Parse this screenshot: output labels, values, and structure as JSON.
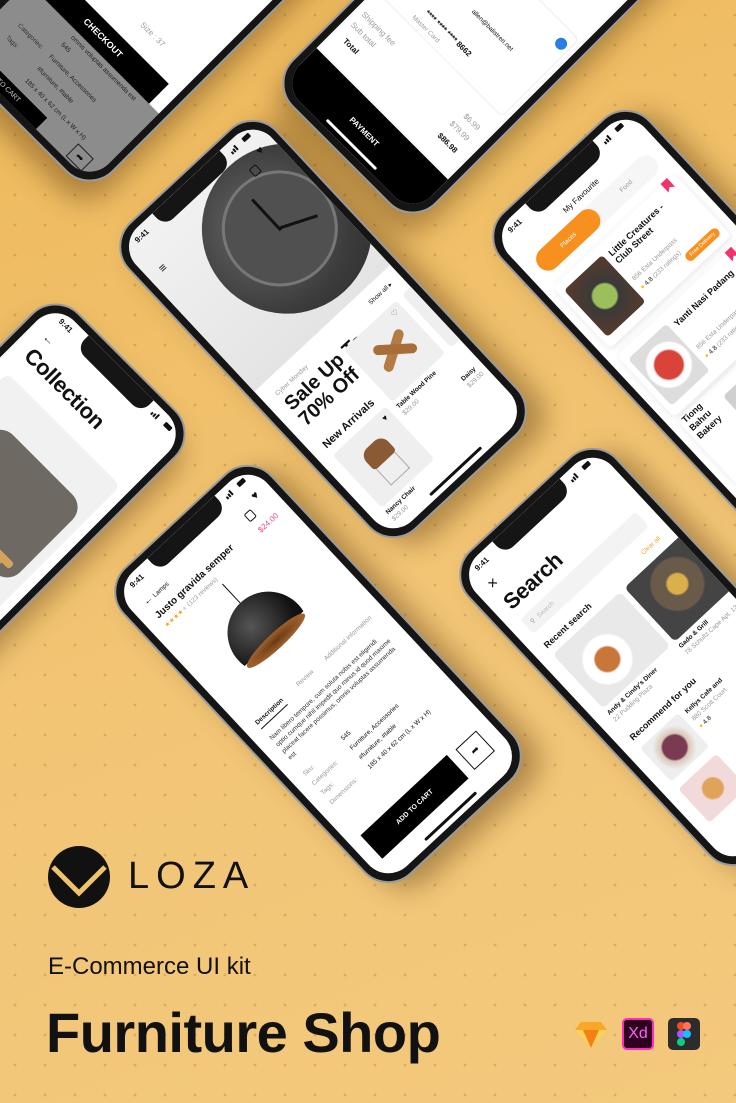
{
  "brand": {
    "name": "LOZA",
    "subtitle": "E-Commerce UI kit",
    "title": "Furniture Shop",
    "tools": [
      "sketch-icon",
      "xd-icon",
      "figma-icon"
    ],
    "xd_label": "Xd"
  },
  "colors": {
    "background": "#f0c26c",
    "orange": "#f7901e",
    "pink": "#f0336b",
    "price": "#e8537a"
  },
  "status_time": "9:41",
  "sale_screen": {
    "eyebrow": "Cyber Monday",
    "headline_1": "Sale Up To",
    "headline_2": "70% Off",
    "section": "New Arrivals",
    "show_all": "Show all",
    "products": [
      {
        "name": "Nancy Chair",
        "price": "$29.00"
      },
      {
        "name": "Table Wood Pine",
        "price": "$29.00"
      },
      {
        "name": "Daisy",
        "price": "$29.00"
      }
    ]
  },
  "product_screen": {
    "back_label": "Lamps",
    "price": "$24.00",
    "title": "Justo gravida semper",
    "rating": 4,
    "reviews": "(123 reviews)",
    "tabs": [
      "Description",
      "Review",
      "Additional information"
    ],
    "description": "Nam libero tempore, cum soluta nobis est eligendi optio cumque nihil impedit quo minus id quod maxime placeat facere possimus, omnis voluptas assumenda est",
    "specs": [
      {
        "label": "Sku:",
        "value": "545"
      },
      {
        "label": "Categories:",
        "value": "Furniture, Accessories"
      },
      {
        "label": "Tags:",
        "value": "#furniture, #table"
      },
      {
        "label": "Dimensions:",
        "value": "185 x 40 x 62 cm (L x W x H)"
      }
    ],
    "add_to_cart": "ADD TO CART"
  },
  "search_screen": {
    "title": "Search",
    "placeholder": "Search",
    "recent": "Recent search",
    "clear_all": "Clear all",
    "recent_items": [
      {
        "name": "Andy & Cindy's Diner",
        "address": "22 Pudding Plaza"
      },
      {
        "name": "Gado & Grill",
        "address": "78 Schultz Cape Apt. 13"
      }
    ],
    "recommend": "Recommend for you",
    "recommend_items": [
      {
        "name": "Kellys Cafe and",
        "address": "880 Scott Court",
        "rating": "4.8"
      }
    ]
  },
  "favourite_screen": {
    "title": "My Favourite",
    "tabs": [
      "Places",
      "Food"
    ],
    "items": [
      {
        "name": "Little Creatures - Club Street",
        "address": "856 Esta Underpass",
        "rating": "4.8",
        "ratings": "(233 ratings)",
        "badge": "Free Delivery"
      },
      {
        "name": "Yanti Nasi Padang",
        "address": "856 Esta Underpass",
        "rating": "4.8",
        "ratings": "(233 ratings)"
      },
      {
        "name": "Tiong Bahru Bakery",
        "address": "",
        "rating": "",
        "ratings": ""
      }
    ]
  },
  "collection_screen": {
    "title": "Collection"
  },
  "checkout_screen": {
    "size": "Size : 37",
    "checkout": "CHECKOUT",
    "desc_tail": "omnis voluptas assumenda est",
    "specs": [
      "545",
      "Furniture, Accessories",
      "#furniture, #table",
      "185 x 40 x 62 cm (L x W x H)"
    ],
    "spec_labels": [
      "Categories:",
      "Tags:"
    ],
    "add_to_cart": "ADD TO CART"
  },
  "payment_screen": {
    "email": "allen@balistreri.net",
    "card_label": "Master Card",
    "card_number": "**** **** **** 8662",
    "rows": [
      {
        "label": "Shipping fee",
        "value": "$6.99"
      },
      {
        "label": "Sub total",
        "value": "$79.99"
      },
      {
        "label": "Total",
        "value": "$86.98"
      }
    ],
    "payment": "PAYMENT"
  }
}
